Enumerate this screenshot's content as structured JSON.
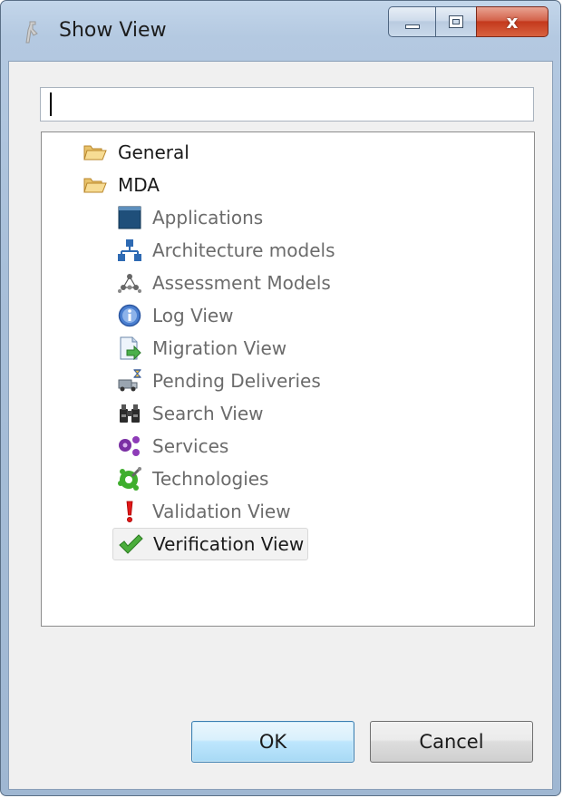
{
  "window": {
    "title": "Show View",
    "close_glyph": "x"
  },
  "filter": {
    "value": "",
    "placeholder": ""
  },
  "tree": {
    "folders": [
      {
        "label": "General",
        "icon": "folder-open-icon",
        "expanded": true
      },
      {
        "label": "MDA",
        "icon": "folder-open-icon",
        "expanded": true
      }
    ],
    "items": [
      {
        "label": "Applications",
        "icon": "applications-icon"
      },
      {
        "label": "Architecture models",
        "icon": "architecture-models-icon"
      },
      {
        "label": "Assessment Models",
        "icon": "assessment-models-icon"
      },
      {
        "label": "Log View",
        "icon": "info-icon"
      },
      {
        "label": "Migration View",
        "icon": "migration-icon"
      },
      {
        "label": "Pending Deliveries",
        "icon": "pending-deliveries-icon"
      },
      {
        "label": "Search View",
        "icon": "binoculars-icon"
      },
      {
        "label": "Services",
        "icon": "services-icon"
      },
      {
        "label": "Technologies",
        "icon": "technologies-icon"
      },
      {
        "label": "Validation View",
        "icon": "exclamation-icon"
      },
      {
        "label": "Verification View",
        "icon": "checkmark-icon",
        "selected": true
      }
    ]
  },
  "buttons": {
    "ok": "OK",
    "cancel": "Cancel"
  }
}
